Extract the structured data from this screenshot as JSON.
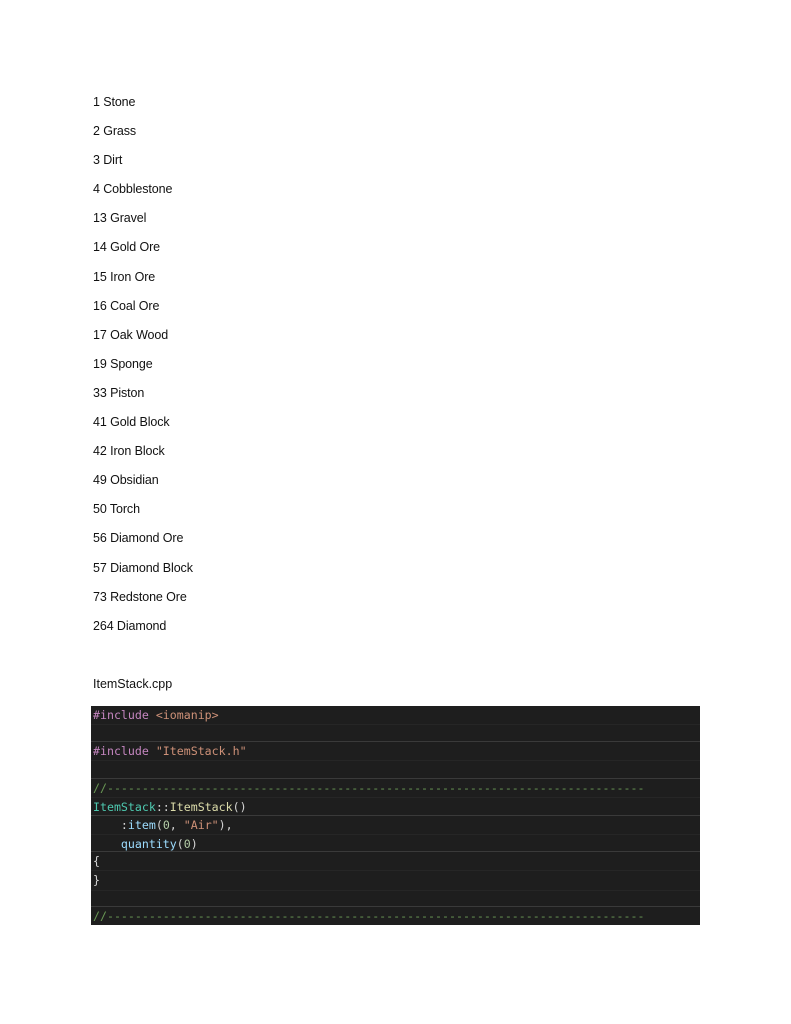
{
  "item_list": [
    {
      "id": "1",
      "name": "Stone",
      "text": "1 Stone"
    },
    {
      "id": "2",
      "name": "Grass",
      "text": "2 Grass"
    },
    {
      "id": "3",
      "name": "Dirt",
      "text": "3 Dirt"
    },
    {
      "id": "4",
      "name": "Cobblestone",
      "text": "4 Cobblestone"
    },
    {
      "id": "13",
      "name": "Gravel",
      "text": "13 Gravel"
    },
    {
      "id": "14",
      "name": "Gold Ore",
      "text": "14 Gold Ore"
    },
    {
      "id": "15",
      "name": "Iron Ore",
      "text": "15 Iron Ore"
    },
    {
      "id": "16",
      "name": "Coal Ore",
      "text": "16 Coal Ore"
    },
    {
      "id": "17",
      "name": "Oak Wood",
      "text": "17 Oak Wood"
    },
    {
      "id": "19",
      "name": "Sponge",
      "text": "19 Sponge"
    },
    {
      "id": "33",
      "name": "Piston",
      "text": "33 Piston"
    },
    {
      "id": "41",
      "name": "Gold Block",
      "text": "41 Gold Block"
    },
    {
      "id": "42",
      "name": "Iron Block",
      "text": "42 Iron Block"
    },
    {
      "id": "49",
      "name": "Obsidian",
      "text": "49 Obsidian"
    },
    {
      "id": "50",
      "name": "Torch",
      "text": "50 Torch"
    },
    {
      "id": "56",
      "name": "Diamond Ore",
      "text": "56 Diamond Ore"
    },
    {
      "id": "57",
      "name": "Diamond Block",
      "text": "57 Diamond Block"
    },
    {
      "id": "73",
      "name": "Redstone Ore",
      "text": "73 Redstone Ore"
    },
    {
      "id": "264",
      "name": "Diamond",
      "text": "264 Diamond"
    }
  ],
  "file": {
    "title": "ItemStack.cpp"
  },
  "code": {
    "include1_directive": "#include",
    "include1_target": " <iomanip>",
    "include2_directive": "#include",
    "include2_target": " \"ItemStack.h\"",
    "separator1": "//-----------------------------------------------------------------------------",
    "ctor_class": "ItemStack",
    "ctor_scope": "::",
    "ctor_name": "ItemStack",
    "ctor_parens": "()",
    "init1_indent": "    ",
    "init1_colon": ":",
    "init1_member": "item",
    "init1_open": "(",
    "init1_num": "0",
    "init1_comma": ", ",
    "init1_str": "\"Air\"",
    "init1_close": "),",
    "init2_indent": "    ",
    "init2_member": "quantity",
    "init2_open": "(",
    "init2_num": "0",
    "init2_close": ")",
    "brace_open": "{",
    "brace_close": "}",
    "separator2": "//-----------------------------------------------------------------------------"
  }
}
